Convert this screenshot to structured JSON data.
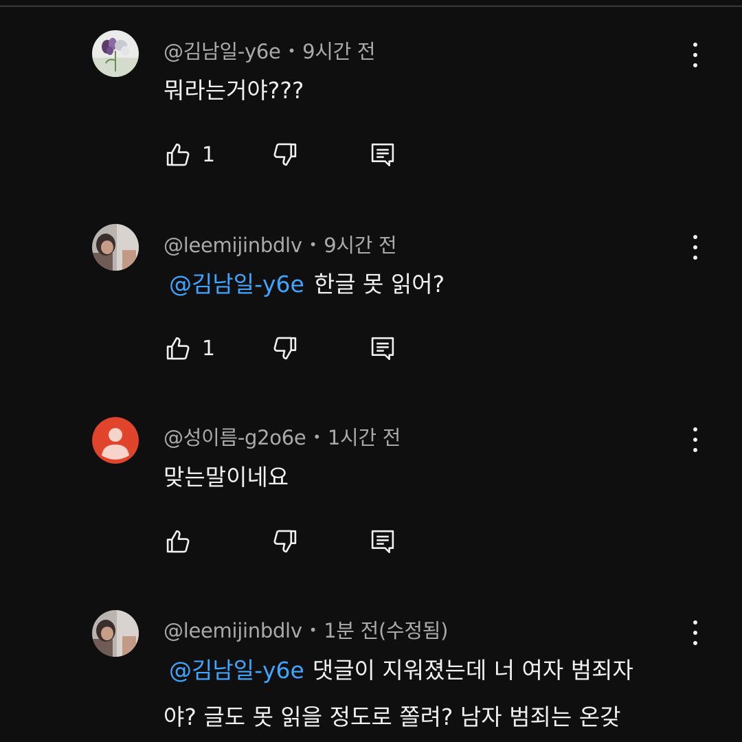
{
  "comments": [
    {
      "author": "@김남일-y6e",
      "time": "9시간 전",
      "mention": "",
      "text": "뭐라는거야???",
      "like_count": "1",
      "avatar": "flower-photo"
    },
    {
      "author": "@leemijinbdlv",
      "time": "9시간 전",
      "mention": "@김남일-y6e",
      "text": "한글 못 읽어?",
      "like_count": "1",
      "avatar": "person-photo"
    },
    {
      "author": "@성이름-g2o6e",
      "time": "1시간 전",
      "mention": "",
      "text": "맞는말이네요",
      "like_count": "",
      "avatar": "default-user-icon"
    },
    {
      "author": "@leemijinbdlv",
      "time": "1분 전(수정됨)",
      "mention": "@김남일-y6e",
      "text": "댓글이 지워졌는데 너 여자 범죄자",
      "text_line2": "야? 글도 못 읽을 정도로 쫄려? 남자 범죄는 온갖",
      "like_count": "",
      "avatar": "person-photo"
    }
  ],
  "colors": {
    "background": "#0f0f0f",
    "text": "#f1f1f1",
    "meta": "#aaaaaa",
    "mention": "#3ea6ff",
    "default_avatar": "#e0452c"
  },
  "icons": [
    "thumb-up-icon",
    "thumb-down-icon",
    "reply-icon",
    "more-vert-icon"
  ]
}
